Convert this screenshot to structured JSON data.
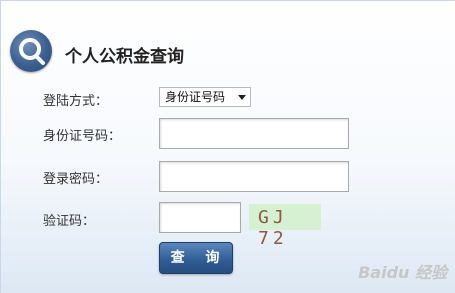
{
  "header": {
    "title": "个人公积金查询",
    "logo_icon": "magnifier-icon"
  },
  "form": {
    "login_method_label": "登陆方式：",
    "login_method_selected": "身份证号码",
    "id_label": "身份证号码：",
    "id_value": "",
    "password_label": "登录密码：",
    "password_value": "",
    "captcha_label": "验证码：",
    "captcha_value": "",
    "captcha_text": "GJ 72",
    "submit_label": "查 询"
  },
  "watermark": "Baidu 经验",
  "colors": {
    "button": "#2f5c94",
    "captcha_bg": "#d6f0d2"
  }
}
